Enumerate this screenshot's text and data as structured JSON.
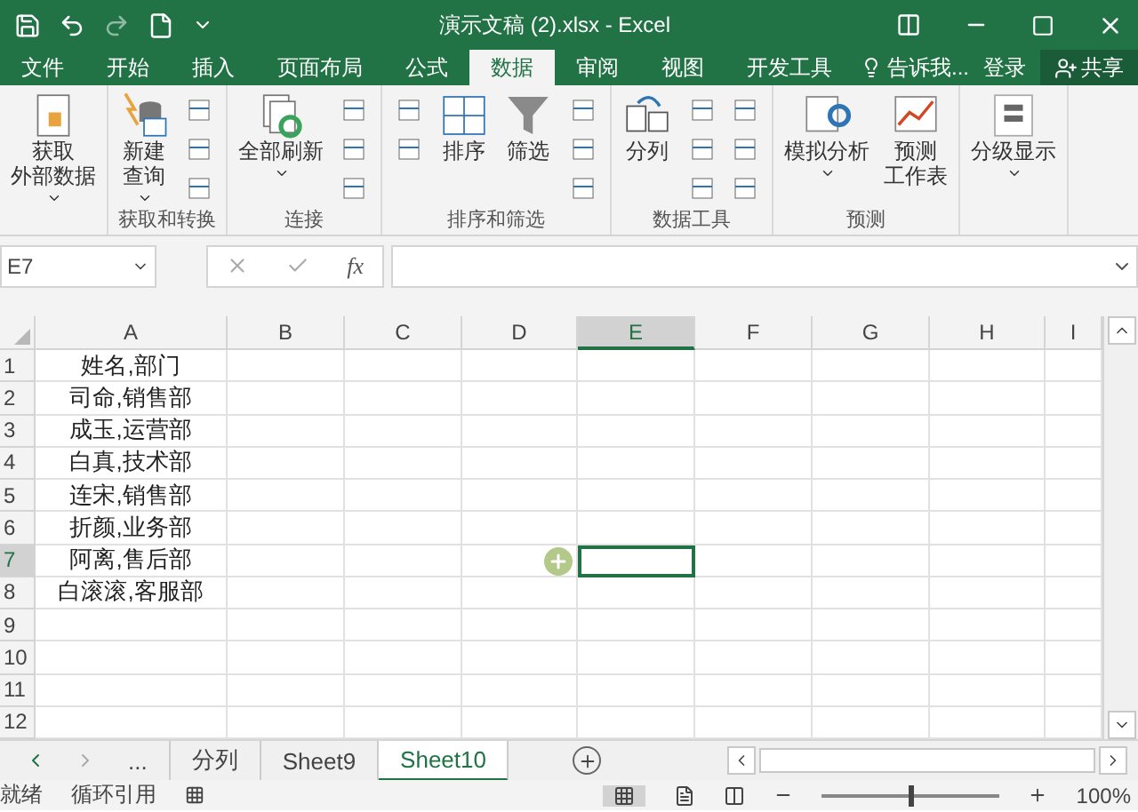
{
  "window": {
    "title": "演示文稿 (2).xlsx - Excel"
  },
  "ribbon_tabs": [
    {
      "label": "文件",
      "selected": false
    },
    {
      "label": "开始",
      "selected": false
    },
    {
      "label": "插入",
      "selected": false
    },
    {
      "label": "页面布局",
      "selected": false
    },
    {
      "label": "公式",
      "selected": false
    },
    {
      "label": "数据",
      "selected": true
    },
    {
      "label": "审阅",
      "selected": false
    },
    {
      "label": "视图",
      "selected": false
    },
    {
      "label": "开发工具",
      "selected": false
    }
  ],
  "tell_me": "告诉我...",
  "sign_in": "登录",
  "share": "共享",
  "ribbon_groups": [
    {
      "items": [
        {
          "kind": "large",
          "lines": [
            "获取",
            "外部数据"
          ],
          "dropdown": true
        }
      ]
    },
    {
      "label": "获取和转换",
      "items": [
        {
          "kind": "large",
          "lines": [
            "新建",
            "查询"
          ],
          "dropdown": true
        },
        {
          "kind": "small"
        },
        {
          "kind": "small"
        },
        {
          "kind": "small"
        }
      ]
    },
    {
      "label": "连接",
      "items": [
        {
          "kind": "large",
          "lines": [
            "全部刷新"
          ],
          "dropdown": true
        },
        {
          "kind": "small"
        },
        {
          "kind": "small"
        },
        {
          "kind": "small"
        }
      ]
    },
    {
      "label": "排序和筛选",
      "items": [
        {
          "kind": "small"
        },
        {
          "kind": "small"
        },
        {
          "kind": "large",
          "lines": [
            "排序"
          ]
        },
        {
          "kind": "large",
          "lines": [
            "筛选"
          ]
        },
        {
          "kind": "small"
        },
        {
          "kind": "small"
        },
        {
          "kind": "small"
        }
      ]
    },
    {
      "label": "数据工具",
      "items": [
        {
          "kind": "large",
          "lines": [
            "分列"
          ]
        },
        {
          "kind": "small"
        },
        {
          "kind": "small"
        },
        {
          "kind": "small"
        },
        {
          "kind": "small"
        },
        {
          "kind": "small"
        },
        {
          "kind": "small"
        }
      ]
    },
    {
      "label": "预测",
      "items": [
        {
          "kind": "large",
          "lines": [
            "模拟分析"
          ],
          "dropdown": true
        },
        {
          "kind": "large",
          "lines": [
            "预测",
            "工作表"
          ]
        }
      ]
    },
    {
      "items": [
        {
          "kind": "large",
          "lines": [
            "分级显示"
          ],
          "dropdown": true
        }
      ]
    }
  ],
  "name_box": "E7",
  "fx": "fx",
  "columns": [
    {
      "label": "A",
      "selected": false
    },
    {
      "label": "B",
      "selected": false
    },
    {
      "label": "C",
      "selected": false
    },
    {
      "label": "D",
      "selected": false
    },
    {
      "label": "E",
      "selected": true
    },
    {
      "label": "F",
      "selected": false
    },
    {
      "label": "G",
      "selected": false
    },
    {
      "label": "H",
      "selected": false
    },
    {
      "label": "I",
      "selected": false
    }
  ],
  "rows": [
    {
      "number": "1",
      "selected": false,
      "a": "姓名,部门"
    },
    {
      "number": "2",
      "selected": false,
      "a": "司命,销售部"
    },
    {
      "number": "3",
      "selected": false,
      "a": "成玉,运营部"
    },
    {
      "number": "4",
      "selected": false,
      "a": "白真,技术部"
    },
    {
      "number": "5",
      "selected": false,
      "a": "连宋,销售部"
    },
    {
      "number": "6",
      "selected": false,
      "a": "折颜,业务部"
    },
    {
      "number": "7",
      "selected": true,
      "a": "阿离,售后部"
    },
    {
      "number": "8",
      "selected": false,
      "a": "白滚滚,客服部"
    },
    {
      "number": "9",
      "selected": false
    },
    {
      "number": "10",
      "selected": false
    },
    {
      "number": "11",
      "selected": false
    },
    {
      "number": "12",
      "selected": false
    }
  ],
  "sheet_more": "...",
  "sheet_tabs": [
    {
      "label": "分列",
      "selected": false
    },
    {
      "label": "Sheet9",
      "selected": false
    },
    {
      "label": "Sheet10",
      "selected": true
    }
  ],
  "status_bar": [
    "就绪",
    "循环引用"
  ],
  "zoom": "100%",
  "zoom_slider": {
    "level": 0.5
  }
}
